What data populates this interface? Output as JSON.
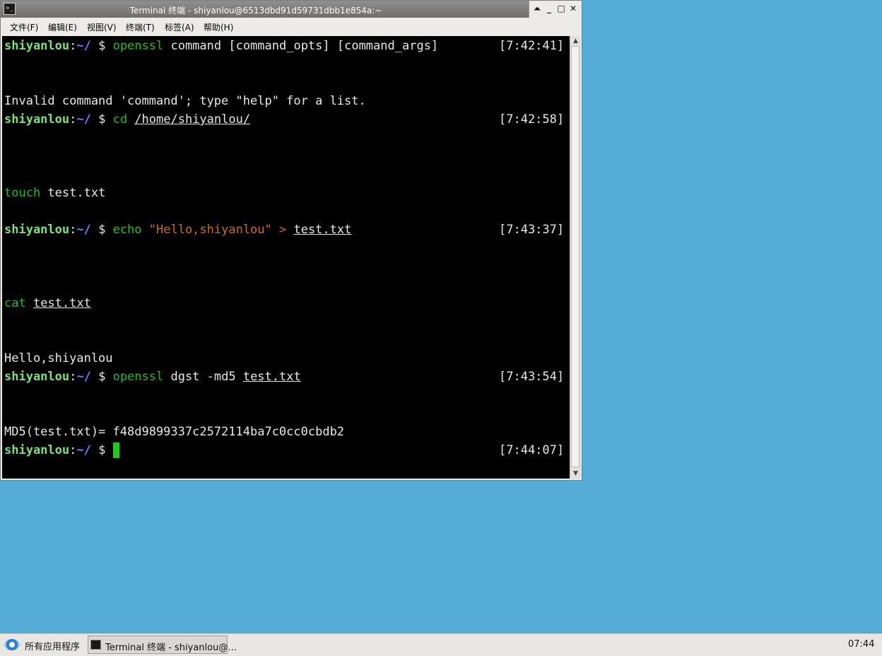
{
  "window": {
    "title": "Terminal 终端 - shiyanlou@6513dbd91d59731dbb1e854a:~",
    "controls": {
      "shade": "⏶",
      "minimize": "_",
      "maximize": "□",
      "close": "✕"
    }
  },
  "menubar": {
    "items": [
      {
        "label": "文件(F)"
      },
      {
        "label": "编辑(E)"
      },
      {
        "label": "视图(V)"
      },
      {
        "label": "终端(T)"
      },
      {
        "label": "标签(A)"
      },
      {
        "label": "帮助(H)"
      }
    ]
  },
  "terminal": {
    "prompt": {
      "user": "shiyanlou",
      "colon": ":",
      "path": "~/",
      "dollar": " $ "
    },
    "l1": {
      "cmd": "openssl",
      "rest": " command [command_opts] [command_args]",
      "time": "[7:42:41]"
    },
    "l2": {
      "text": "Invalid command 'command'; type \"help\" for a list."
    },
    "l3": {
      "cmd": "cd",
      "arg": "/home/shiyanlou/",
      "time": "[7:42:58]"
    },
    "l4": {
      "cmd": "touch",
      "rest": " test.txt"
    },
    "l5": {
      "cmd": "echo",
      "str": " \"Hello,shiyanlou\" > ",
      "arg": "test.txt",
      "time": "[7:43:37]"
    },
    "l6": {
      "cmd": "cat",
      "arg": "test.txt"
    },
    "l7": {
      "text": "Hello,shiyanlou"
    },
    "l8": {
      "cmd": "openssl",
      "rest": " dgst -md5 ",
      "arg": "test.txt",
      "time": "[7:43:54]"
    },
    "l9": {
      "text": "MD5(test.txt)= f48d9899337c2572114ba7c0cc0cbdb2"
    },
    "l10": {
      "time": "[7:44:07]"
    }
  },
  "taskbar": {
    "start_label": "所有应用程序",
    "task_label": "Terminal 终端 - shiyanlou@…",
    "clock": "07:44"
  },
  "colors": {
    "desktop": "#55acd6",
    "terminal_bg": "#000000",
    "user": "#7de07d",
    "path": "#7b7bff",
    "command": "#26b826",
    "string": "#c86b1e",
    "cursor": "#23c623"
  }
}
